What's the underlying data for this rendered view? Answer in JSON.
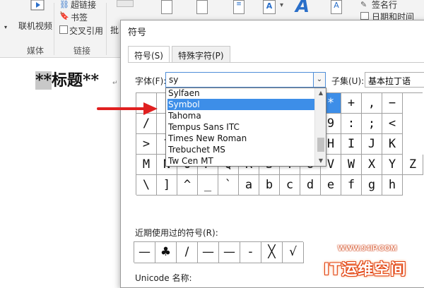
{
  "ribbon": {
    "hyperlink": "超链接",
    "bookmark": "书签",
    "crossref": "交叉引用",
    "online_video": "联机视频",
    "group_media": "媒体",
    "group_links": "链接",
    "partial_char": "批",
    "signature_line": "签名行",
    "datetime": "日期和时间"
  },
  "document": {
    "heading_prefix": "**",
    "heading_text": "标题",
    "heading_suffix": "**",
    "para_mark": "↵"
  },
  "dialog": {
    "title": "符号",
    "tabs": [
      "符号(S)",
      "特殊字符(P)"
    ],
    "font_label": "字体(F):",
    "font_value": "sy",
    "subset_label": "子集(U):",
    "subset_value": "基本拉丁语",
    "font_options": [
      "Sylfaen",
      "Symbol",
      "Tahoma",
      "Tempus Sans ITC",
      "Times New Roman",
      "Trebuchet MS",
      "Tw Cen MT"
    ],
    "selected_font": "Symbol",
    "recent_label": "近期使用过的符号(R):",
    "unicode_label": "Unicode 名称:"
  },
  "grid": {
    "rows": [
      [
        "",
        "",
        "",
        "",
        "",
        "",
        "",
        "",
        ")",
        "*",
        "+",
        ",",
        "−"
      ],
      [
        "/",
        "(",
        "",
        "",
        "",
        "",
        "",
        "",
        "8",
        "9",
        ":",
        ";",
        "<"
      ],
      [
        ">",
        "?",
        "",
        "",
        "",
        "",
        "",
        "",
        "G",
        "H",
        "I",
        "J",
        "K"
      ],
      [
        "M",
        "N",
        "O",
        "P",
        "Q",
        "R",
        "S",
        "T",
        "U",
        "V",
        "W",
        "X",
        "Y",
        "Z"
      ],
      [
        "\\",
        "]",
        "^",
        "_",
        "`",
        "a",
        "b",
        "c",
        "d",
        "e",
        "f",
        "g",
        "h"
      ]
    ],
    "highlighted": "*"
  },
  "recent_symbols": [
    "—",
    "♣",
    "/",
    "—",
    "—",
    "-",
    "╳",
    "√"
  ],
  "watermark": {
    "url": "WWW.94IP.COM",
    "name": "IT运维空间"
  },
  "colors": {
    "accent": "#3d8ee8",
    "arrow": "#e02020",
    "watermark": "#e04010"
  }
}
